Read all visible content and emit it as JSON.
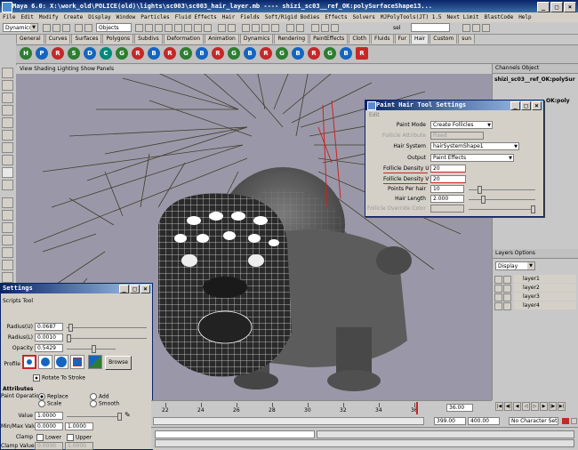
{
  "window": {
    "title": "Maya 6.0: X:\\work_old\\POLICE(old)\\lights\\sc003\\sc003_hair_layer.mb   ----   shizi_sc03__ref_OK:polySurfaceShape13...",
    "minimize": "_",
    "maximize": "□",
    "close": "×"
  },
  "menubar": [
    "File",
    "Edit",
    "Modify",
    "Create",
    "Display",
    "Window",
    "Particles",
    "Fluid Effects",
    "Hair",
    "Fields",
    "Soft/Rigid Bodies",
    "Effects",
    "Solvers",
    "MJPolyTools(JT) 1.5",
    "Next Limit",
    "BlastCode",
    "Help"
  ],
  "statusline": {
    "menuset": "Dynamics",
    "selection_mask": "Objects",
    "sel_label": "sel"
  },
  "shelf": {
    "tabs": [
      "General",
      "Curves",
      "Surfaces",
      "Polygons",
      "Subdivs",
      "Deformation",
      "Animation",
      "Dynamics",
      "Rendering",
      "PaintEffects",
      "Cloth",
      "Fluids",
      "Fur",
      "Hair",
      "Custom",
      "sun"
    ],
    "active_tab": "Hair"
  },
  "viewport": {
    "menu": [
      "View",
      "Shading",
      "Lighting",
      "Show",
      "Panels"
    ]
  },
  "channel_box": {
    "menu": [
      "Channels",
      "Object"
    ],
    "object_name": "shizi_sc03__ref_OK:polySur",
    "object_name_2": "OK:poly"
  },
  "layers": {
    "menu": [
      "Layers",
      "Options"
    ],
    "display": "Display",
    "items": [
      "layer1",
      "layer2",
      "layer3",
      "layer4"
    ]
  },
  "hair_tool": {
    "title": "Paint Hair Tool Settings",
    "menu": "Edit",
    "paint_mode_label": "Paint Mode",
    "paint_mode": "Create Follicles",
    "follicle_attr_label": "Follicle Attribute",
    "follicle_attr": "Fixed",
    "hair_system_label": "Hair System",
    "hair_system": "hairSystemShape1",
    "output_label": "Output",
    "output": "Paint Effects",
    "density_u_label": "Follicle Density U",
    "density_u": "20",
    "density_v_label": "Follicle Density V",
    "density_v": "20",
    "points_label": "Points Per hair",
    "points": "10",
    "length_label": "Hair Length",
    "length": "2.000",
    "override_label": "Follicle Override Color"
  },
  "paint_settings": {
    "title": "Settings",
    "subtitle": "Scripts Tool",
    "radius_u_label": "Radius(U)",
    "radius_u": "0.0687",
    "radius_l_label": "Radius(L)",
    "radius_l": "0.0010",
    "opacity_label": "Opacity",
    "opacity": "0.5429",
    "profile_label": "Profile",
    "browse": "Browse",
    "rotate_label": "Rotate To Stroke",
    "attributes_header": "Attributes",
    "paint_op_label": "Paint Operation",
    "op_replace": "Replace",
    "op_add": "Add",
    "op_scale": "Scale",
    "op_smooth": "Smooth",
    "value_label": "Value",
    "value": "1.0000",
    "minmax_label": "Min/Max Value",
    "min": "0.0000",
    "max": "1.0000",
    "clamp_label": "Clamp",
    "clamp_lower": "Lower",
    "clamp_upper": "Upper",
    "clamp_values_label": "Clamp Values",
    "clamp_min": "0.0000",
    "clamp_max": "1.0000"
  },
  "timeline": {
    "ticks": [
      "22",
      "24",
      "26",
      "28",
      "30",
      "32",
      "34",
      "36"
    ],
    "current": "36.00"
  },
  "range": {
    "start": "399.00",
    "end": "400.00",
    "character_set": "No Character Set"
  }
}
